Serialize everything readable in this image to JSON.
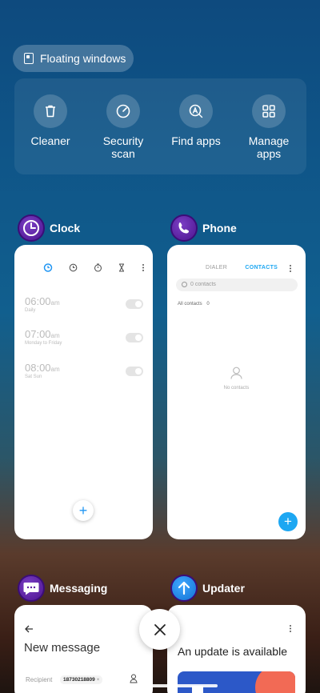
{
  "floating_windows": {
    "label": "Floating windows"
  },
  "tools": [
    {
      "label": "Cleaner",
      "icon": "trash-icon"
    },
    {
      "label": "Security\nscan",
      "icon": "shield-gauge-icon"
    },
    {
      "label": "Find apps",
      "icon": "app-search-icon"
    },
    {
      "label": "Manage\napps",
      "icon": "grid-icon"
    }
  ],
  "apps": {
    "clock": {
      "title": "Clock",
      "alarms": [
        {
          "time": "06:00",
          "ampm": "am",
          "sub": "Daily"
        },
        {
          "time": "07:00",
          "ampm": "am",
          "sub": "Monday to Friday"
        },
        {
          "time": "08:00",
          "ampm": "am",
          "sub": "Sat Sun"
        }
      ],
      "fab": "+"
    },
    "phone": {
      "title": "Phone",
      "tab_dialer": "DIALER",
      "tab_contacts": "CONTACTS",
      "search_placeholder": "0 contacts",
      "group_label": "All contacts",
      "group_count": "0",
      "empty_text": "No contacts",
      "fab": "+"
    },
    "messaging": {
      "title": "Messaging",
      "heading": "New message",
      "recipient_label": "Recipient",
      "recipient_value": "18730218809"
    },
    "updater": {
      "title": "Updater",
      "heading": "An update is available"
    }
  },
  "colors": {
    "accent_blue": "#1da7f2",
    "alarm_active": "#2196f3",
    "update_red": "#f26a55",
    "update_blue": "#2c58c8"
  }
}
